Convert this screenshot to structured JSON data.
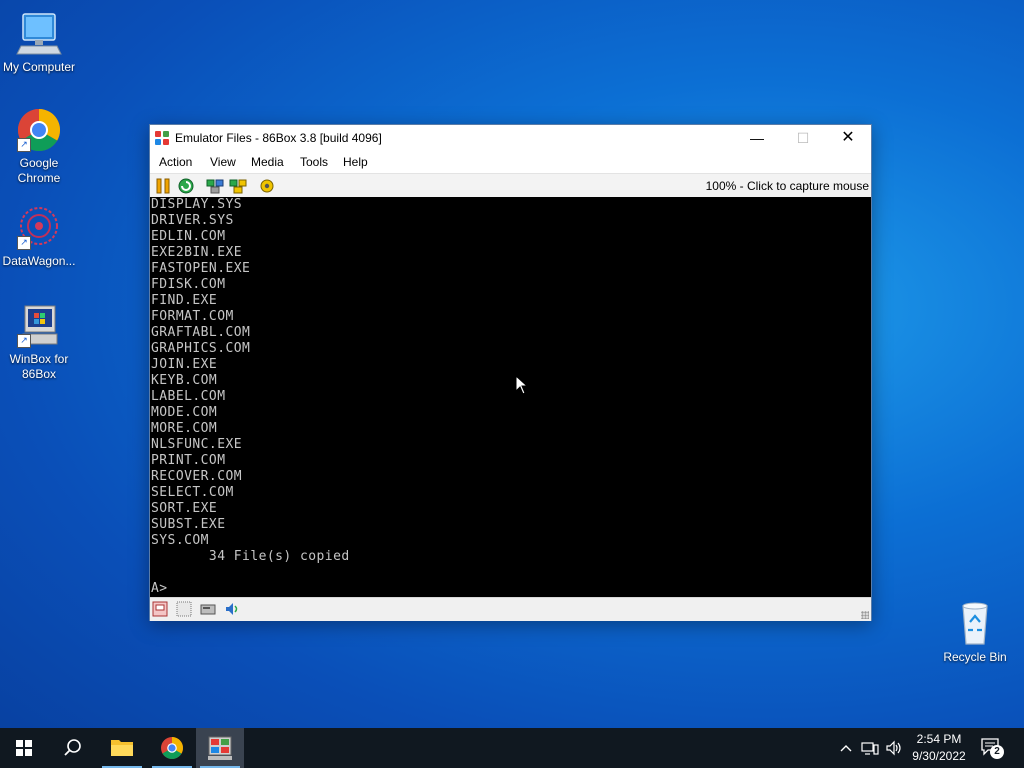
{
  "desktop": {
    "icons": [
      {
        "label": "My Computer",
        "icon": "computer-icon"
      },
      {
        "label": "Google Chrome",
        "icon": "chrome-icon"
      },
      {
        "label": "DataWagon...",
        "icon": "datawagon-icon"
      },
      {
        "label": "WinBox for 86Box",
        "icon": "winbox-icon"
      },
      {
        "label": "Recycle Bin",
        "icon": "recycle-bin-icon"
      }
    ]
  },
  "window": {
    "title": "Emulator Files - 86Box 3.8 [build 4096]",
    "controls": {
      "minimize": "—",
      "maximize": "☐",
      "close": "✕"
    },
    "menu": [
      "Action",
      "View",
      "Media",
      "Tools",
      "Help"
    ],
    "toolbar": {
      "buttons": [
        "pause-icon",
        "hard-reset-icon",
        "ctrl-alt-del-icon",
        "ctrl-alt-esc-icon",
        "settings-icon"
      ],
      "capture_text": "100% - Click to capture mouse"
    },
    "screen_lines": [
      "DISPLAY.SYS",
      "DRIVER.SYS",
      "EDLIN.COM",
      "EXE2BIN.EXE",
      "FASTOPEN.EXE",
      "FDISK.COM",
      "FIND.EXE",
      "FORMAT.COM",
      "GRAFTABL.COM",
      "GRAPHICS.COM",
      "JOIN.EXE",
      "KEYB.COM",
      "LABEL.COM",
      "MODE.COM",
      "MORE.COM",
      "NLSFUNC.EXE",
      "PRINT.COM",
      "RECOVER.COM",
      "SELECT.COM",
      "SORT.EXE",
      "SUBST.EXE",
      "SYS.COM",
      "       34 File(s) copied",
      "",
      "A>"
    ],
    "statusbar": [
      "floppy-drive-icon",
      "cdrom-icon",
      "hard-disk-icon",
      "sound-icon"
    ]
  },
  "taskbar": {
    "buttons": [
      "start-icon",
      "search-icon",
      "file-explorer-icon",
      "chrome-icon",
      "86box-icon"
    ],
    "tray": {
      "icons": [
        "chevron-up-icon",
        "network-icon",
        "volume-icon"
      ],
      "time": "2:54 PM",
      "date": "9/30/2022",
      "notification_count": "2"
    }
  },
  "colors": {
    "terminal_bg": "#000000",
    "terminal_fg": "#c6c6c6",
    "taskbar": "#101820",
    "accent": "#0a6fd4"
  }
}
